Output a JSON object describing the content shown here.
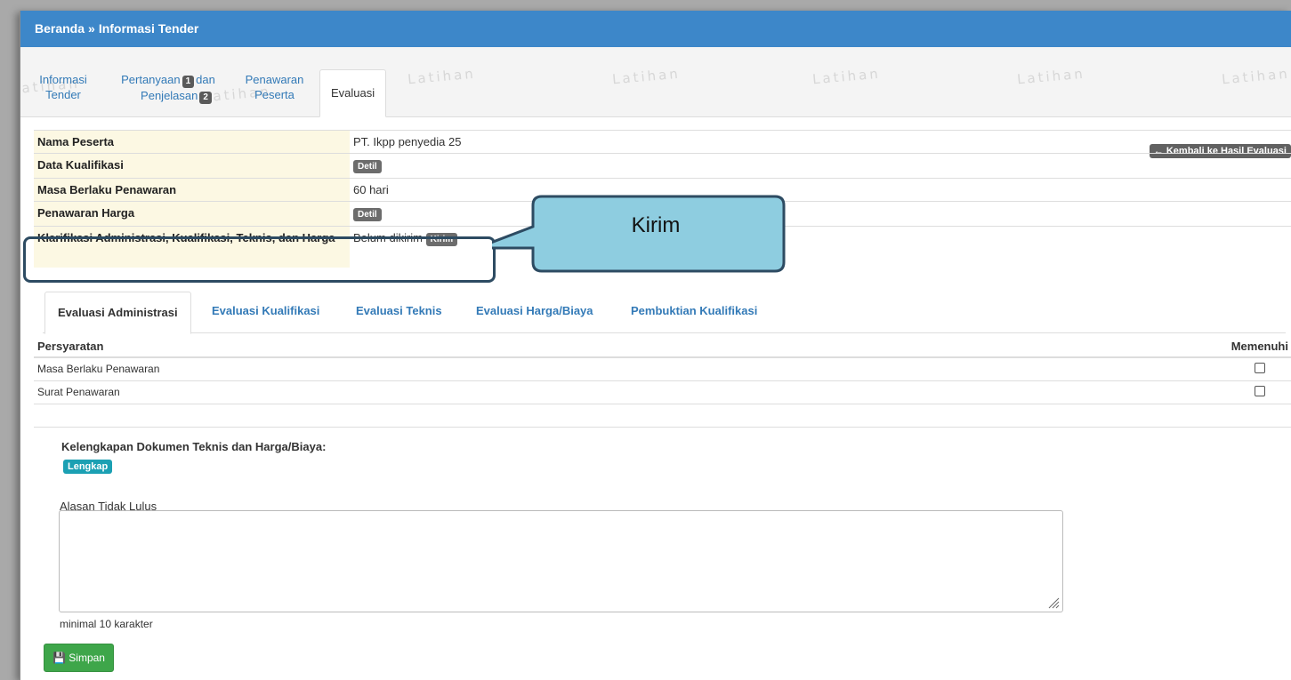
{
  "header": {
    "breadcrumb_home": "Beranda",
    "breadcrumb_sep": "»",
    "breadcrumb_current": "Informasi Tender"
  },
  "top_tabs": {
    "info_line1": "Informasi",
    "info_line2": "Tender",
    "pertanyaan_line1": "Pertanyaan",
    "pertanyaan_badge": "1",
    "pertanyaan_dan": "dan",
    "penjelasan_line2": "Penjelasan",
    "penjelasan_badge": "2",
    "penawaran_line1": "Penawaran",
    "penawaran_line2": "Peserta",
    "evaluasi": "Evaluasi"
  },
  "watermark": "Latihan",
  "info": {
    "nama_peserta_label": "Nama Peserta",
    "nama_peserta_value": "PT. Ikpp penyedia 25",
    "data_kualifikasi_label": "Data Kualifikasi",
    "detil": "Detil",
    "masa_berlaku_label": "Masa Berlaku Penawaran",
    "masa_berlaku_value": "60 hari",
    "penawaran_harga_label": "Penawaran Harga",
    "klarifikasi_label": "Klarifikasi Administrasi, Kualifikasi, Teknis, dan Harga",
    "klarifikasi_status": "Belum dikirim",
    "kirim_button": "Kirim",
    "back_button": "Kembali ke Hasil Evaluasi"
  },
  "callout": "Kirim",
  "eval_tabs": [
    "Evaluasi Administrasi",
    "Evaluasi Kualifikasi",
    "Evaluasi Teknis",
    "Evaluasi Harga/Biaya",
    "Pembuktian Kualifikasi"
  ],
  "requirements": {
    "col_persyaratan": "Persyaratan",
    "col_memenuhi": "Memenuhi",
    "rows": [
      "Masa Berlaku Penawaran",
      "Surat Penawaran"
    ]
  },
  "kelengkapan": {
    "title": "Kelengkapan Dokumen Teknis dan Harga/Biaya:",
    "status": "Lengkap"
  },
  "alasan": {
    "label": "Alasan Tidak Lulus",
    "hint": "minimal 10 karakter"
  },
  "save_button": "Simpan",
  "colors": {
    "header_blue": "#3d87c9",
    "label_bg": "#fcf8e3",
    "success_green": "#3ea64a",
    "info_teal": "#1ba0b3",
    "callout_fill": "#8ecde0",
    "callout_border": "#2d4b62"
  }
}
